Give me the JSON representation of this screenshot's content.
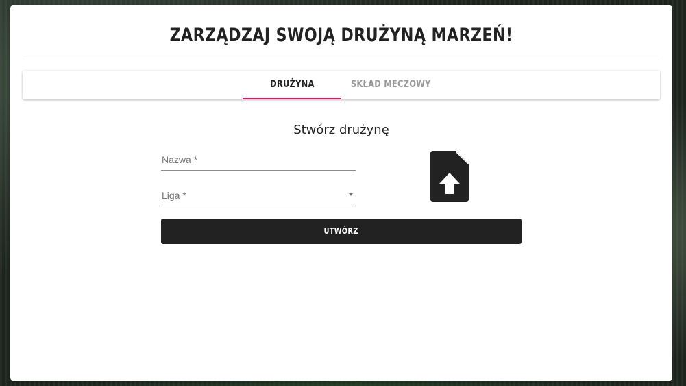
{
  "page": {
    "title": "ZARZĄDZAJ SWOJĄ DRUŻYNĄ MARZEŃ!"
  },
  "tabs": [
    {
      "label": "DRUŻYNA",
      "active": true
    },
    {
      "label": "SKŁAD MECZOWY",
      "active": false
    }
  ],
  "form": {
    "heading": "Stwórz drużynę",
    "name_field": {
      "label": "Nazwa *",
      "value": ""
    },
    "league_field": {
      "label": "Liga *",
      "selected": ""
    },
    "upload_icon": "file-upload-icon",
    "submit_label": "UTWÓRZ"
  },
  "colors": {
    "accent": "#e0115f",
    "button_bg": "#222222",
    "text_dark": "#222222",
    "tab_inactive": "#9a9a9a"
  }
}
